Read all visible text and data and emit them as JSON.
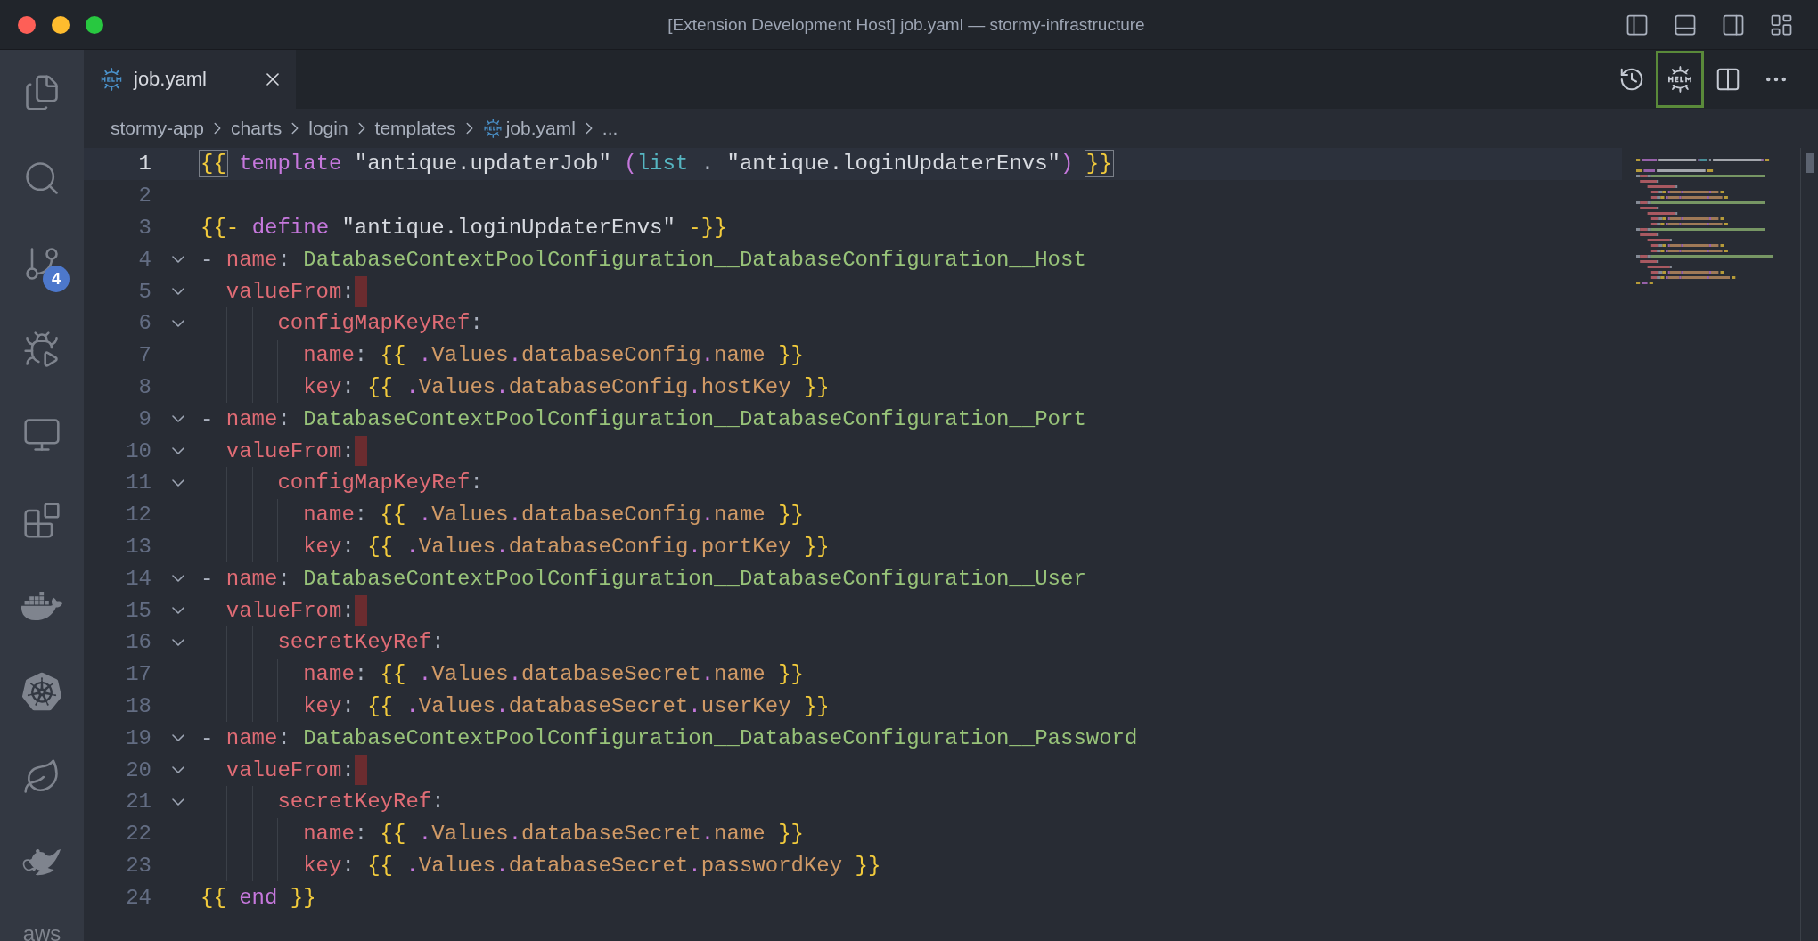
{
  "window": {
    "title": "[Extension Development Host] job.yaml — stormy-infrastructure"
  },
  "activity_bar": {
    "source_control_badge": "4",
    "bottom_label": "aws"
  },
  "tabs": [
    {
      "label": "job.yaml",
      "selected": true
    }
  ],
  "editor_actions": [
    {
      "kind": "history",
      "highlighted": false
    },
    {
      "kind": "helm",
      "highlighted": true
    },
    {
      "kind": "split",
      "highlighted": false
    },
    {
      "kind": "more",
      "highlighted": false
    }
  ],
  "breadcrumbs": [
    {
      "label": "stormy-app",
      "kind": "folder"
    },
    {
      "label": "charts",
      "kind": "folder"
    },
    {
      "label": "login",
      "kind": "folder"
    },
    {
      "label": "templates",
      "kind": "folder"
    },
    {
      "label": "job.yaml",
      "kind": "file"
    },
    {
      "label": "...",
      "kind": "folder"
    }
  ],
  "lines": [
    {
      "number": "1",
      "current": true,
      "bracket_match": true,
      "foldable": false,
      "trailing_whitespace": false,
      "text": "{{ template \"antique.updaterJob\" (list . \"antique.loginUpdaterEnvs\") }}"
    },
    {
      "number": "2",
      "current": false,
      "foldable": false,
      "trailing_whitespace": false
    },
    {
      "number": "3",
      "current": false,
      "bracket_match": false,
      "foldable": false,
      "trailing_whitespace": false,
      "text": "{{- define \"antique.loginUpdaterEnvs\" -}}"
    },
    {
      "number": "4",
      "current": false,
      "bracket_match": false,
      "foldable": true,
      "trailing_whitespace": false,
      "text": "- name: DatabaseContextPoolConfiguration__DatabaseConfiguration__Host"
    },
    {
      "number": "5",
      "current": false,
      "bracket_match": false,
      "foldable": true,
      "trailing_whitespace": true,
      "text": "  valueFrom:"
    },
    {
      "number": "6",
      "current": false,
      "bracket_match": false,
      "foldable": true,
      "trailing_whitespace": false,
      "text": "      configMapKeyRef:"
    },
    {
      "number": "7",
      "current": false,
      "bracket_match": false,
      "foldable": false,
      "trailing_whitespace": false,
      "text": "        name: {{ .Values.databaseConfig.name }}"
    },
    {
      "number": "8",
      "current": false,
      "bracket_match": false,
      "foldable": false,
      "trailing_whitespace": false,
      "text": "        key: {{ .Values.databaseConfig.hostKey }}"
    },
    {
      "number": "9",
      "current": false,
      "bracket_match": false,
      "foldable": true,
      "trailing_whitespace": false,
      "text": "- name: DatabaseContextPoolConfiguration__DatabaseConfiguration__Port"
    },
    {
      "number": "10",
      "current": false,
      "bracket_match": false,
      "foldable": true,
      "trailing_whitespace": true,
      "text": "  valueFrom:"
    },
    {
      "number": "11",
      "current": false,
      "bracket_match": false,
      "foldable": true,
      "trailing_whitespace": false,
      "text": "      configMapKeyRef:"
    },
    {
      "number": "12",
      "current": false,
      "bracket_match": false,
      "foldable": false,
      "trailing_whitespace": false,
      "text": "        name: {{ .Values.databaseConfig.name }}"
    },
    {
      "number": "13",
      "current": false,
      "bracket_match": false,
      "foldable": false,
      "trailing_whitespace": false,
      "text": "        key: {{ .Values.databaseConfig.portKey }}"
    },
    {
      "number": "14",
      "current": false,
      "bracket_match": false,
      "foldable": true,
      "trailing_whitespace": false,
      "text": "- name: DatabaseContextPoolConfiguration__DatabaseConfiguration__User"
    },
    {
      "number": "15",
      "current": false,
      "bracket_match": false,
      "foldable": true,
      "trailing_whitespace": true,
      "text": "  valueFrom:"
    },
    {
      "number": "16",
      "current": false,
      "bracket_match": false,
      "foldable": true,
      "trailing_whitespace": false,
      "text": "      secretKeyRef:"
    },
    {
      "number": "17",
      "current": false,
      "bracket_match": false,
      "foldable": false,
      "trailing_whitespace": false,
      "text": "        name: {{ .Values.databaseSecret.name }}"
    },
    {
      "number": "18",
      "current": false,
      "bracket_match": false,
      "foldable": false,
      "trailing_whitespace": false,
      "text": "        key: {{ .Values.databaseSecret.userKey }}"
    },
    {
      "number": "19",
      "current": false,
      "bracket_match": false,
      "foldable": true,
      "trailing_whitespace": false,
      "text": "- name: DatabaseContextPoolConfiguration__DatabaseConfiguration__Password"
    },
    {
      "number": "20",
      "current": false,
      "bracket_match": false,
      "foldable": true,
      "trailing_whitespace": true,
      "text": "  valueFrom:"
    },
    {
      "number": "21",
      "current": false,
      "bracket_match": false,
      "foldable": true,
      "trailing_whitespace": false,
      "text": "      secretKeyRef:"
    },
    {
      "number": "22",
      "current": false,
      "bracket_match": false,
      "foldable": false,
      "trailing_whitespace": false,
      "text": "        name: {{ .Values.databaseSecret.name }}"
    },
    {
      "number": "23",
      "current": false,
      "bracket_match": false,
      "foldable": false,
      "trailing_whitespace": false,
      "text": "        key: {{ .Values.databaseSecret.passwordKey }}"
    },
    {
      "number": "24",
      "current": false,
      "bracket_match": false,
      "foldable": false,
      "trailing_whitespace": false,
      "text": "{{ end }}"
    }
  ]
}
